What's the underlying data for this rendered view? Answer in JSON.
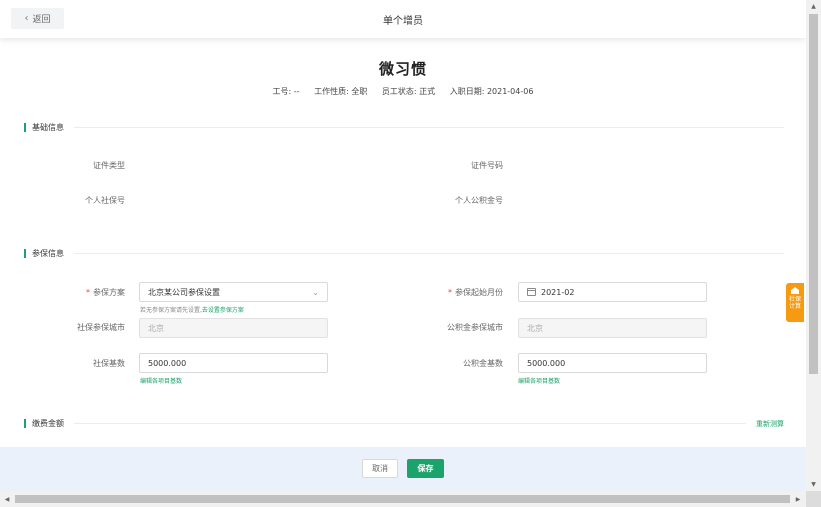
{
  "header": {
    "back_label": "返回",
    "title": "单个增员"
  },
  "employee": {
    "name": "微习惯",
    "meta": [
      "工号: --",
      "工作性质: 全职",
      "员工状态: 正式",
      "入职日期: 2021-04-06"
    ]
  },
  "basic_section": {
    "title": "基础信息",
    "fields": {
      "id_type_label": "证件类型",
      "id_number_label": "证件号码",
      "social_no_label": "个人社保号",
      "fund_no_label": "个人公积金号"
    }
  },
  "insurance_section": {
    "title": "参保信息",
    "plan_label": "参保方案",
    "plan_value": "北京某公司参保设置",
    "plan_hint": "若无参保方案请先设置,",
    "plan_hint_link": "去设置参保方案",
    "start_label": "参保起始月份",
    "start_value": "2021-02",
    "social_city_label": "社保参保城市",
    "social_city_value": "北京",
    "fund_city_label": "公积金参保城市",
    "fund_city_value": "北京",
    "social_base_label": "社保基数",
    "social_base_value": "5000.000",
    "fund_base_label": "公积金基数",
    "fund_base_value": "5000.000",
    "edit_base_link": "编辑各项目基数"
  },
  "payment_section": {
    "title": "缴费金额",
    "recalc_link": "重新测算"
  },
  "footer": {
    "cancel_label": "取消",
    "save_label": "保存"
  },
  "float_calc": {
    "line1": "社保",
    "line2": "计算"
  },
  "colors": {
    "accent": "#1aa36b",
    "required": "#e5484d",
    "float_button": "#f59a11",
    "footer_bg": "#eaf1fb"
  }
}
